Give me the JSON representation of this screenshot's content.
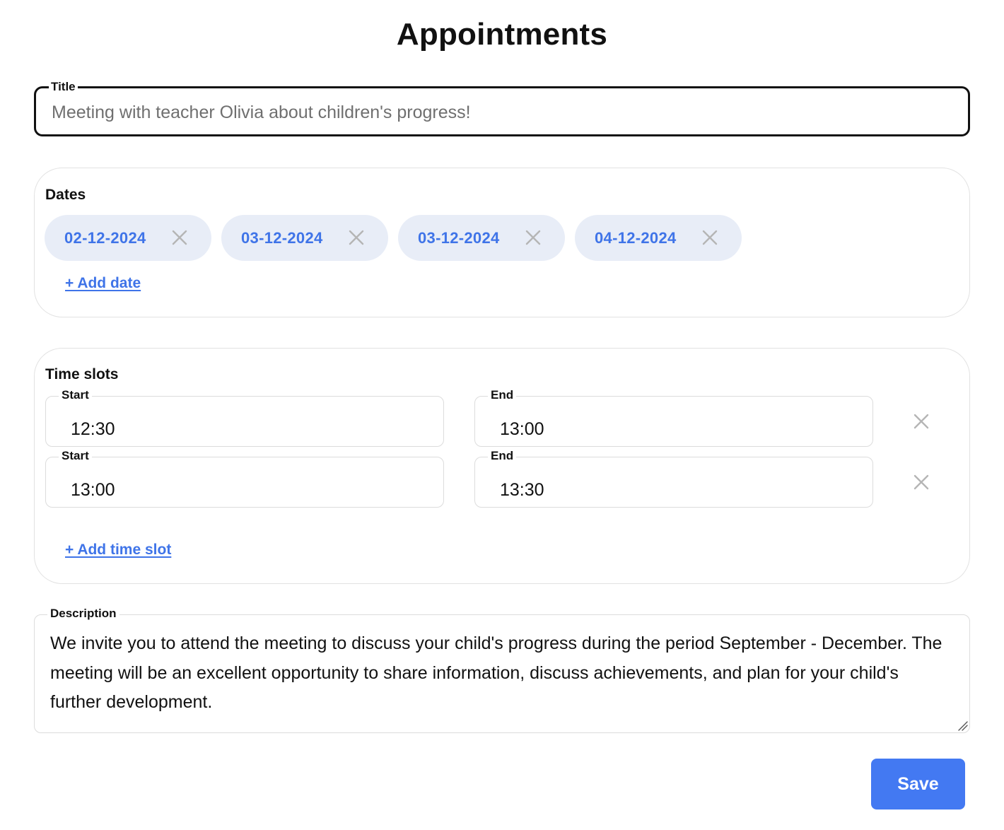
{
  "page": {
    "title": "Appointments"
  },
  "title_field": {
    "label": "Title",
    "value": "Meeting with teacher Olivia about children's progress!"
  },
  "dates": {
    "heading": "Dates",
    "items": [
      {
        "label": "02-12-2024"
      },
      {
        "label": "03-12-2024"
      },
      {
        "label": "03-12-2024"
      },
      {
        "label": "04-12-2024"
      }
    ],
    "add_label": "+ Add date",
    "remove_icon": "close-icon"
  },
  "time_slots": {
    "heading": "Time slots",
    "start_label": "Start",
    "end_label": "End",
    "items": [
      {
        "start": "12:30",
        "end": "13:00"
      },
      {
        "start": "13:00",
        "end": "13:30"
      }
    ],
    "add_label": "+ Add time slot",
    "remove_icon": "close-icon"
  },
  "description": {
    "label": "Description",
    "value": "We invite you to attend the meeting to discuss your child's progress during the period September - December. The meeting will be an excellent opportunity to share information, discuss achievements, and plan for your child's further development."
  },
  "actions": {
    "save_label": "Save"
  },
  "colors": {
    "accent": "#4379f2",
    "chip_background": "#e8edf7",
    "chip_text": "#3f74e8",
    "muted_icon": "#b5b5b5",
    "border": "#dcdcdc"
  }
}
